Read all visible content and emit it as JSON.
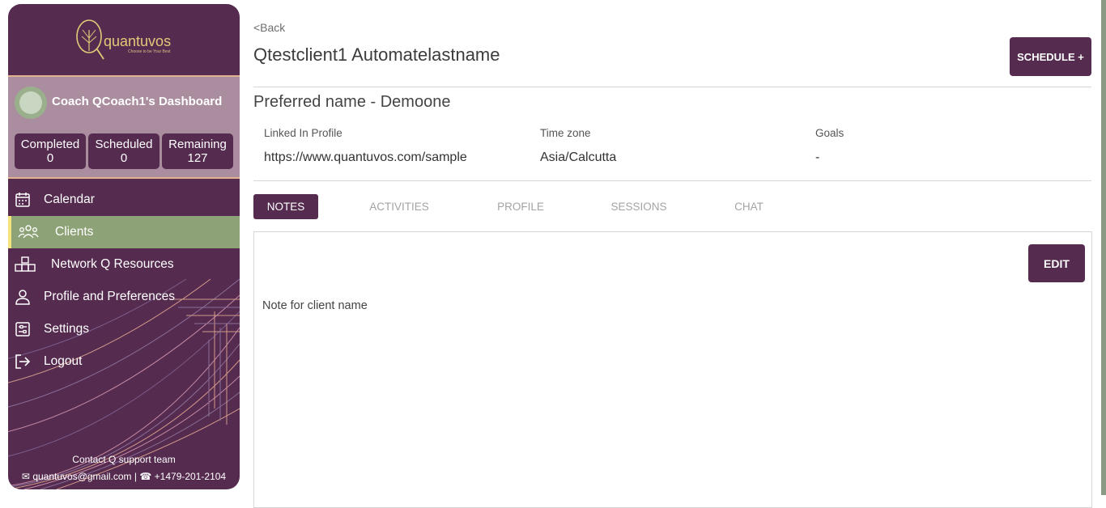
{
  "sidebar": {
    "logo": {
      "name": "quantuvos",
      "tagline": "Choose to be Your Best"
    },
    "dashboard_title": "Coach QCoach1's Dashboard",
    "stats": [
      {
        "label": "Completed",
        "value": "0"
      },
      {
        "label": "Scheduled",
        "value": "0"
      },
      {
        "label": "Remaining",
        "value": "127"
      }
    ],
    "nav": [
      {
        "label": "Calendar",
        "icon": "calendar-icon",
        "active": false
      },
      {
        "label": "Clients",
        "icon": "users-icon",
        "active": true
      },
      {
        "label": "Network Q Resources",
        "icon": "network-icon",
        "active": false
      },
      {
        "label": "Profile and Preferences",
        "icon": "user-icon",
        "active": false
      },
      {
        "label": "Settings",
        "icon": "settings-icon",
        "active": false
      },
      {
        "label": "Logout",
        "icon": "logout-icon",
        "active": false
      }
    ],
    "contact": {
      "title": "Contact Q support team",
      "email": "quantuvos@gmail.com",
      "separator": "|",
      "phone": "+1479-201-2104"
    }
  },
  "header": {
    "back_label": "<Back",
    "client_name": "Qtestclient1 Automatelastname",
    "schedule_label": "SCHEDULE +"
  },
  "profile": {
    "preferred_name": "Preferred name  - Demoone",
    "fields": [
      {
        "label": "Linked In Profile",
        "value": "https://www.quantuvos.com/sample"
      },
      {
        "label": "Time zone",
        "value": "Asia/Calcutta"
      },
      {
        "label": "Goals",
        "value": "-"
      }
    ]
  },
  "tabs": [
    {
      "label": "NOTES",
      "active": true
    },
    {
      "label": "ACTIVITIES",
      "active": false
    },
    {
      "label": "PROFILE",
      "active": false
    },
    {
      "label": "SESSIONS",
      "active": false
    },
    {
      "label": "CHAT",
      "active": false
    }
  ],
  "notes": {
    "edit_label": "EDIT",
    "text": "Note for client name"
  },
  "colors": {
    "brand_purple": "#552b4f",
    "active_green": "#8da277",
    "dashboard_mauve": "#aa8e9f",
    "logo_gold": "#e3c978"
  }
}
